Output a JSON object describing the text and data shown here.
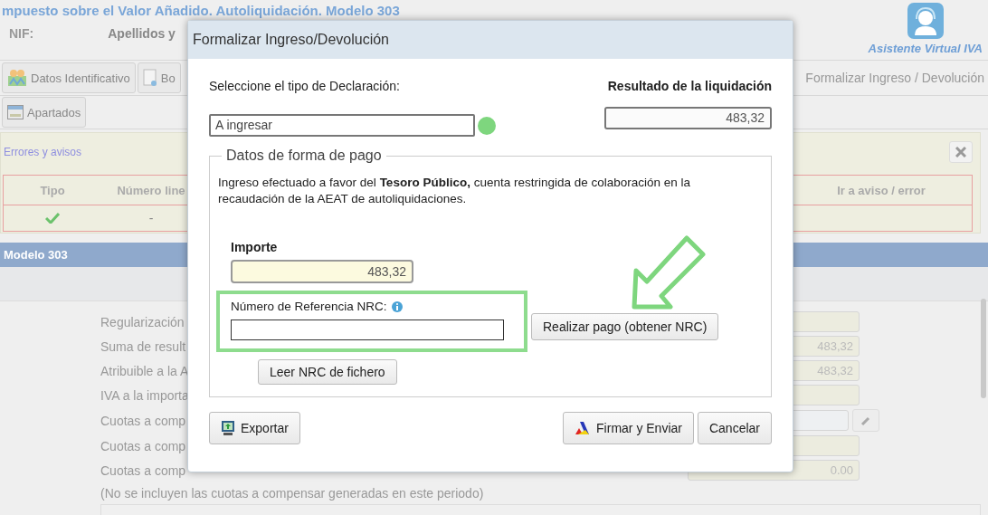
{
  "page": {
    "title": "mpuesto sobre el Valor Añadido. Autoliquidación. Modelo 303",
    "nif_label": "NIF:",
    "name_label": "Apellidos y",
    "assistant": "Asistente Virtual IVA"
  },
  "tabs": [
    {
      "label": "Datos Identificativo",
      "kind": "people"
    },
    {
      "label": "Bo",
      "kind": "document"
    }
  ],
  "current_step": "Formalizar Ingreso / Devolución",
  "tabs_row_2": [
    {
      "label": "Apartados",
      "kind": "window"
    }
  ],
  "errors_panel": {
    "title": "Errores y avisos",
    "columns": [
      "Tipo",
      "Número line",
      "Ir a aviso / error"
    ],
    "rows": [
      {
        "kind": "ok",
        "line": "-"
      }
    ]
  },
  "section": {
    "title": "Modelo 303"
  },
  "form_rows": [
    {
      "label": "Regularización",
      "kind": "field"
    },
    {
      "label": "Suma de result",
      "kind": "field",
      "value": "483,32"
    },
    {
      "label": "Atribuible a la A",
      "kind": "field",
      "value": "483,32"
    },
    {
      "label": "IVA a la importa",
      "kind": "field"
    },
    {
      "label": "Cuotas a comp",
      "kind": "editable"
    },
    {
      "label": "Cuotas a comp",
      "kind": "field"
    },
    {
      "label": "Cuotas a comp",
      "kind": "field",
      "value": "0.00"
    }
  ],
  "note": "(No se incluyen las cuotas a compensar generadas en este periodo)",
  "dialog": {
    "title": "Formalizar Ingreso/Devolución",
    "type_label": "Seleccione el tipo de Declaración:",
    "type_value": "A ingresar",
    "result_label": "Resultado de la liquidación",
    "result_value": "483,32",
    "payment": {
      "legend": "Datos de forma de pago",
      "text": "Ingreso efectuado a favor del  **Tesoro Público,**  cuenta restringida de colaboración en la recaudación de la AEAT de autoliquidaciones.",
      "amount_label": "Importe",
      "amount_value": "483,32",
      "nrc_label": "Número de Referencia  NRC:",
      "pay_button": "Realizar pago (obtener NRC)",
      "read_button": "Leer NRC de fichero"
    },
    "buttons": [
      {
        "label": "Exportar",
        "kind": "export"
      },
      {
        "label": "Firmar y Enviar",
        "kind": "sign"
      },
      {
        "label": "Cancelar",
        "kind": "plain"
      }
    ]
  }
}
